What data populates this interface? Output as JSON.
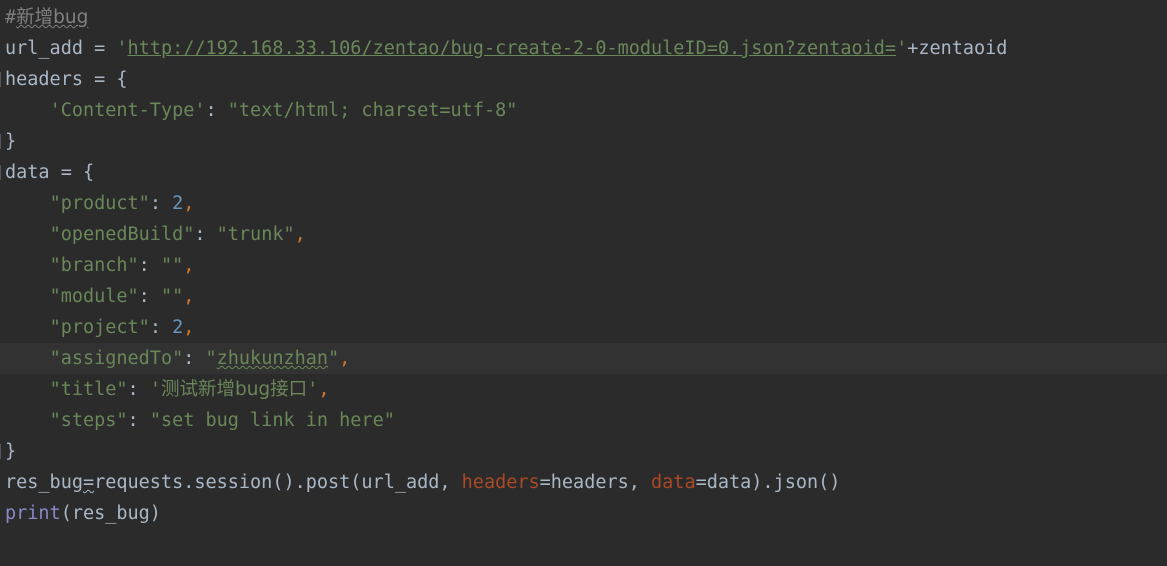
{
  "editor": {
    "colors": {
      "background": "#2b2b2b",
      "current_line": "#323232",
      "plain": "#a9b7c6",
      "comment": "#808080",
      "string": "#6a8759",
      "number": "#6897bb",
      "keyword": "#cc7832",
      "builtin": "#8888c6",
      "param": "#aa4926"
    },
    "lines": {
      "l1": {
        "hash": "#",
        "text": "新增bug"
      },
      "l2": {
        "var": "url_add",
        "eq": " = ",
        "q1": "'",
        "url": "http://192.168.33.106/zentao/bug-create-2-0-moduleID=0.json?zentaoid=",
        "q2": "'",
        "concat": "+zentaoid"
      },
      "l3": {
        "text": "headers = {"
      },
      "l4": {
        "indent": "    ",
        "key": "'Content-Type'",
        "colon": ": ",
        "value": "\"text/html; charset=utf-8\""
      },
      "l5": {
        "text": "}"
      },
      "l6": {
        "text": "data = {"
      },
      "l7": {
        "indent": "    ",
        "key": "\"product\"",
        "colon": ": ",
        "value": "2",
        "comma": ","
      },
      "l8": {
        "indent": "    ",
        "key": "\"openedBuild\"",
        "colon": ": ",
        "value": "\"trunk\"",
        "comma": ","
      },
      "l9": {
        "indent": "    ",
        "key": "\"branch\"",
        "colon": ": ",
        "value": "\"\"",
        "comma": ","
      },
      "l10": {
        "indent": "    ",
        "key": "\"module\"",
        "colon": ": ",
        "value": "\"\"",
        "comma": ","
      },
      "l11": {
        "indent": "    ",
        "key": "\"project\"",
        "colon": ": ",
        "value": "2",
        "comma": ","
      },
      "l12": {
        "indent": "    ",
        "key": "\"assignedTo\"",
        "colon": ": ",
        "vq1": "\"",
        "value": "zhukunzhan",
        "vq2": "\"",
        "comma": ","
      },
      "l13": {
        "indent": "    ",
        "key": "\"title\"",
        "colon": ": ",
        "vq1": "'",
        "value": "测试新增bug接口",
        "vq2": "'",
        "comma": ","
      },
      "l14": {
        "indent": "    ",
        "key": "\"steps\"",
        "colon": ": ",
        "value": "\"set bug link in here\""
      },
      "l15": {
        "text": "}"
      },
      "l16": {
        "var": "res_bug",
        "eq": "=",
        "call": "requests.session().post(url_add, ",
        "p1": "headers",
        "p1v": "=headers, ",
        "p2": "data",
        "p2v": "=data).json()"
      },
      "l17": {
        "fn": "print",
        "args": "(res_bug)"
      }
    }
  }
}
